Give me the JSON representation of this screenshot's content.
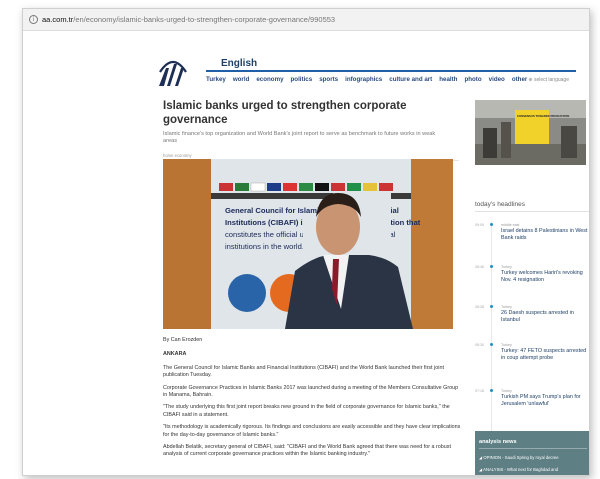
{
  "browser": {
    "url_host": "aa.com.tr",
    "url_path": "/en/economy/islamic-banks-urged-to-strengthen-corporate-governance/990553"
  },
  "site": {
    "edition": "English",
    "nav": [
      "Turkey",
      "world",
      "economy",
      "politics",
      "sports",
      "infographics",
      "culture and art",
      "health",
      "photo",
      "video",
      "other"
    ],
    "language_selector": "select language"
  },
  "article": {
    "title": "Islamic banks urged to strengthen corporate governance",
    "summary": "Islamic finance's top organization and World Bank's joint report to serve as benchmark to future works in weak areas",
    "breadcrumb": "home   economy",
    "byline": "By Can Erozden",
    "dateline": "ANKARA",
    "paragraphs": [
      "The General Council for Islamic Banks and Financial Institutions (CIBAFI) and the World Bank launched their first joint publication Tuesday.",
      "Corporate Governance Practices in Islamic Banks 2017 was launched during a meeting of the Members Consultative Group in Manama, Bahrain.",
      "\"The study underlying this first joint report breaks new ground in the field of corporate governance for Islamic banks,\" the CIBAFI said in a statement.",
      "\"Its methodology is academically rigorous. Its findings and conclusions are easily accessible and they have clear implications for the day-to-day governance of Islamic banks.\"",
      "Abdellah Belatik, secretary general of CIBAFI, said: \"CIBAFI and the World Bank agreed that there was need for a robust analysis of current corporate governance practices within the Islamic banking industry.\""
    ],
    "photo_banner": {
      "line1": "General Council for Islamic Banks and Financial",
      "line2": "Institutions (CIBAFI) is an international institution that",
      "line3": "constitutes the official umbrella for Islamic financial",
      "line4": "institutions in the world.",
      "circle1": "Objective 1 Policy, Regulatory Advocacy",
      "circle2": "Objective 2 Research & Publications"
    }
  },
  "promo": {
    "text": "CONSENSUS TOWARDS PRODUCTION"
  },
  "headlines": {
    "title": "today's headlines",
    "items": [
      {
        "time": "09:09",
        "category": "middle east",
        "text": "Israel detains 8 Palestinians in West Bank raids"
      },
      {
        "time": "08:46",
        "category": "Turkey",
        "text": "Turkey welcomes Hariri's revoking Nov. 4 resignation"
      },
      {
        "time": "08:38",
        "category": "Turkey",
        "text": "26 Daesh suspects arrested in Istanbul"
      },
      {
        "time": "08:30",
        "category": "Turkey",
        "text": "Turkey: 47 FETO suspects arrested in coup attempt probe"
      },
      {
        "time": "07:16",
        "category": "Turkey",
        "text": "Turkish PM says Trump's plan for Jerusalem 'unlawful'"
      }
    ]
  },
  "analysis": {
    "title": "analysis news",
    "items": [
      "OPINION - Saudi Spring by royal decree",
      "ANALYSIS - What next for Baghdad and"
    ]
  },
  "colors": {
    "nav_blue": "#2a4a80",
    "headline_blue": "#1e3f66",
    "timeline_dot": "#1e90c7",
    "analysis_bg": "#5e7f84"
  }
}
